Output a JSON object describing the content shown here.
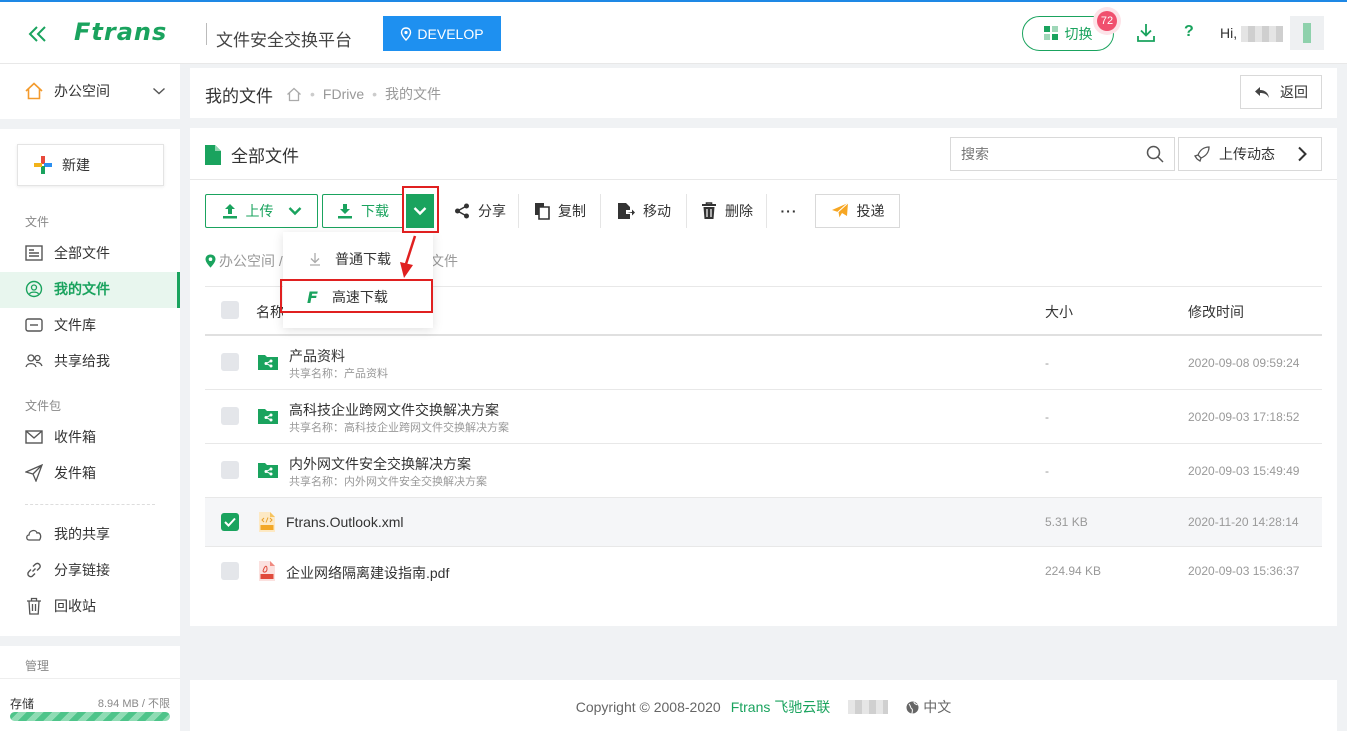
{
  "header": {
    "brand": "Ftrans",
    "platform_name": "文件安全交换平台",
    "env_label": "DEVELOP",
    "switch_label": "切换",
    "switch_badge": "72",
    "help": "?",
    "greeting": "Hi,"
  },
  "sidebar": {
    "workspace": "办公空间",
    "new_button": "新建",
    "group_files": "文件",
    "items_files": [
      "全部文件",
      "我的文件",
      "文件库",
      "共享给我"
    ],
    "group_pack": "文件包",
    "items_pack": [
      "收件箱",
      "发件箱"
    ],
    "items_share": [
      "我的共享",
      "分享链接",
      "回收站"
    ],
    "group_admin": "管理",
    "storage_label": "存储",
    "storage_value": "8.94 MB / 不限",
    "storage_percent": 100
  },
  "page": {
    "title": "我的文件",
    "breadcrumb": [
      "FDrive",
      "我的文件"
    ],
    "back_label": "返回"
  },
  "files_card": {
    "title": "全部文件",
    "search_placeholder": "搜索",
    "upload_activity": "上传动态",
    "toolbar": {
      "upload": "上传",
      "download": "下载",
      "share": "分享",
      "copy": "复制",
      "move": "移动",
      "delete": "删除",
      "more": "···",
      "deliver": "投递"
    },
    "path": {
      "root": "办公空间 /",
      "current": "文件"
    },
    "dropdown": {
      "normal": "普通下载",
      "fast": "高速下载"
    },
    "columns": {
      "name": "名称",
      "size": "大小",
      "modified": "修改时间"
    },
    "rows": [
      {
        "name": "产品资料",
        "sub": "共享名称：产品资料",
        "size": "-",
        "time": "2020-09-08 09:59:24",
        "checked": false
      },
      {
        "name": "高科技企业跨网文件交换解决方案",
        "sub": "共享名称：高科技企业跨网文件交换解决方案",
        "size": "-",
        "time": "2020-09-03 17:18:52",
        "checked": false
      },
      {
        "name": "内外网文件安全交换解决方案",
        "sub": "共享名称：内外网文件安全交换解决方案",
        "size": "-",
        "time": "2020-09-03 15:49:49",
        "checked": false
      },
      {
        "name": "Ftrans.Outlook.xml",
        "sub": "",
        "size": "5.31 KB",
        "time": "2020-11-20 14:28:14",
        "checked": true
      },
      {
        "name": "企业网络隔离建设指南.pdf",
        "sub": "",
        "size": "224.94 KB",
        "time": "2020-09-03 15:36:37",
        "checked": false
      }
    ]
  },
  "footer": {
    "copyright": "Copyright © 2008-2020",
    "brand": "Ftrans 飞驰云联",
    "language": "中文"
  },
  "colors": {
    "accent": "#1aa35e",
    "env": "#1e90f0",
    "highlight": "#e02020",
    "badge": "#f0506e"
  }
}
